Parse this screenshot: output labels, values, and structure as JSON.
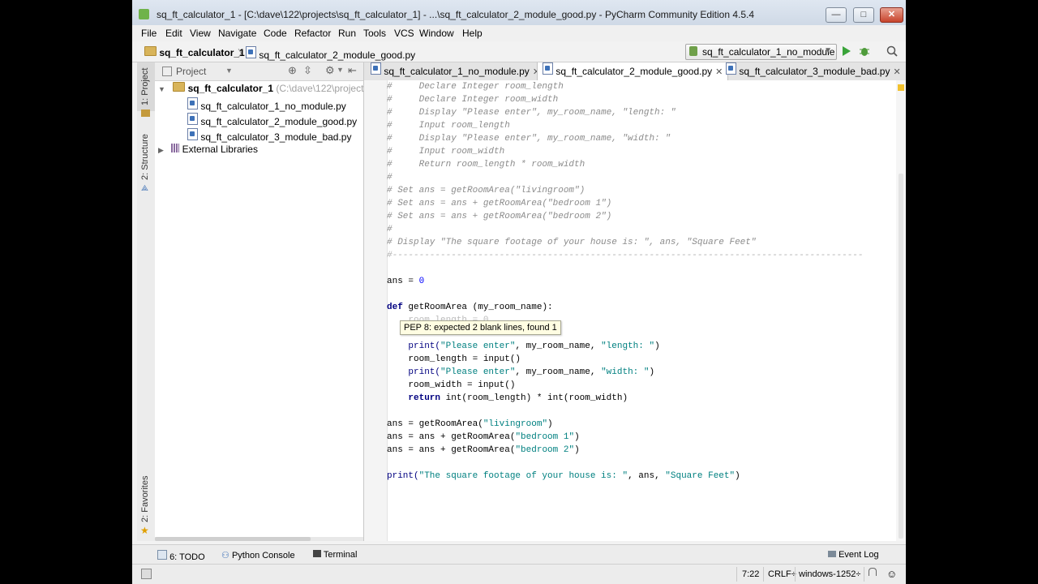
{
  "window": {
    "title": "sq_ft_calculator_1 - [C:\\dave\\122\\projects\\sq_ft_calculator_1] - ...\\sq_ft_calculator_2_module_good.py - PyCharm Community Edition 4.5.4",
    "min": "—",
    "max": "□",
    "close": "✕"
  },
  "menu": [
    "File",
    "Edit",
    "View",
    "Navigate",
    "Code",
    "Refactor",
    "Run",
    "Tools",
    "VCS",
    "Window",
    "Help"
  ],
  "nav": {
    "crumb1": "sq_ft_calculator_1",
    "crumb2": "sq_ft_calculator_2_module_good.py",
    "run_config": "sq_ft_calculator_1_no_module"
  },
  "sidebar": {
    "project_tab": "1: Project",
    "structure_tab": "2: Structure",
    "favorites_tab": "2: Favorites"
  },
  "project": {
    "header": "Project",
    "root": "sq_ft_calculator_1",
    "root_path": "(C:\\dave\\122\\projects\\sq",
    "files": [
      "sq_ft_calculator_1_no_module.py",
      "sq_ft_calculator_2_module_good.py",
      "sq_ft_calculator_3_module_bad.py"
    ],
    "external": "External Libraries"
  },
  "tabs": [
    "sq_ft_calculator_1_no_module.py",
    "sq_ft_calculator_2_module_good.py",
    "sq_ft_calculator_3_module_bad.py"
  ],
  "tooltip": "PEP 8: expected 2 blank lines, found 1",
  "code": {
    "c1": "#     Declare Integer room_length",
    "c2": "#     Declare Integer room_width",
    "c3": "#     Display \"Please enter\", my_room_name, \"length: \"",
    "c4": "#     Input room_length",
    "c5": "#     Display \"Please enter\", my_room_name, \"width: \"",
    "c6": "#     Input room_width",
    "c7": "#     Return room_length * room_width",
    "c8": "#",
    "c9": "# Set ans = getRoomArea(\"livingroom\")",
    "c10": "# Set ans = ans + getRoomArea(\"bedroom 1\")",
    "c11": "# Set ans = ans + getRoomArea(\"bedroom 2\")",
    "c12": "#",
    "c13": "# Display \"The square footage of your house is: \", ans, \"Square Feet\"",
    "c14": "#----------------------------------------------------------------------------------------",
    "ans0": "ans = ",
    "zero": "0",
    "def": "def",
    "defrest": " getRoomArea (my_room_name):",
    "hidden": "    room_length = 0",
    "p1a": "    print(",
    "p1s": "\"Please enter\"",
    "p1b": ", my_room_name, ",
    "p1s2": "\"length: \"",
    "p1c": ")",
    "rl": "    room_length = input()",
    "p2a": "    print(",
    "p2s": "\"Please enter\"",
    "p2b": ", my_room_name, ",
    "p2s2": "\"width: \"",
    "p2c": ")",
    "rw": "    room_width = input()",
    "ret": "    return",
    "retrest": " int(room_length) * int(room_width)",
    "a1a": "ans = getRoomArea(",
    "a1s": "\"livingroom\"",
    "a1c": ")",
    "a2a": "ans = ans + getRoomArea(",
    "a2s": "\"bedroom 1\"",
    "a2c": ")",
    "a3a": "ans = ans + getRoomArea(",
    "a3s": "\"bedroom 2\"",
    "a3c": ")",
    "pfa": "print(",
    "pfs": "\"The square footage of your house is: \"",
    "pfb": ", ans, ",
    "pfs2": "\"Square Feet\"",
    "pfc": ")"
  },
  "bottom": {
    "todo": "6: TODO",
    "console": "Python Console",
    "terminal": "Terminal",
    "eventlog": "Event Log"
  },
  "status": {
    "pos": "7:22",
    "crlf": "CRLF÷",
    "enc": "windows-1252÷"
  }
}
